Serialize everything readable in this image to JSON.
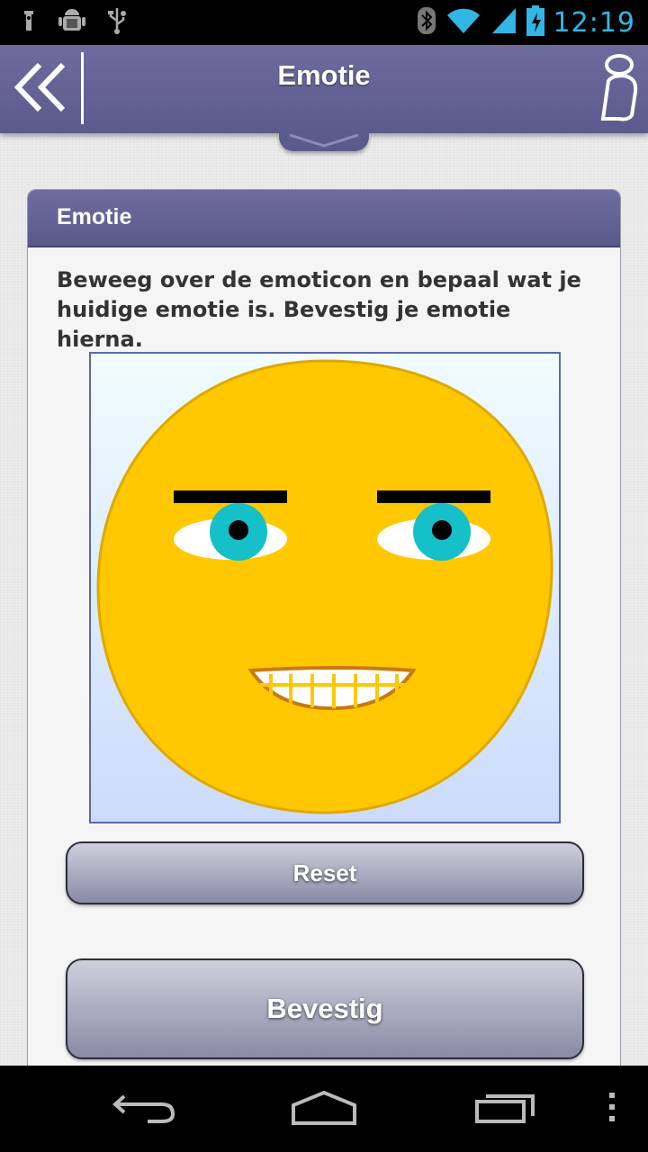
{
  "status_bar": {
    "time": "12:19",
    "icons": [
      "usb-debug-icon",
      "android-debug-icon",
      "usb-icon",
      "bluetooth-icon",
      "wifi-icon",
      "signal-icon",
      "battery-charging-icon"
    ]
  },
  "action_bar": {
    "title": "Emotie",
    "back_icon": "double-chevron-left-icon",
    "profile_icon": "person-icon",
    "pull_tab_icon": "double-chevron-down-icon"
  },
  "card": {
    "header": "Emotie",
    "instruction": "Beweeg over de emoticon en bepaal wat je huidige emotie is. Bevestig je emotie hierna."
  },
  "emoticon": {
    "face_color": "#ffc800",
    "outline_color": "#e0a800",
    "eye_color": "#16c0c8",
    "mouth_color": "#c87a10"
  },
  "buttons": {
    "reset": "Reset",
    "confirm": "Bevestig"
  },
  "nav_bar": {
    "icons": [
      "back-icon",
      "home-icon",
      "recent-apps-icon",
      "menu-icon"
    ]
  },
  "colors": {
    "accent": "#5b5a8c",
    "status_blue": "#33b5e5"
  }
}
